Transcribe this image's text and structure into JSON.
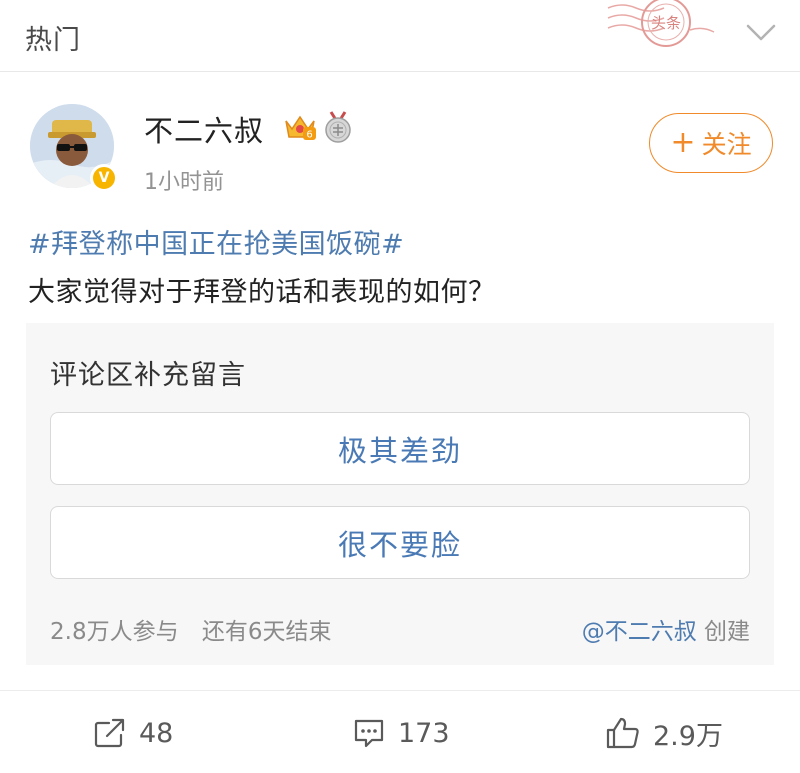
{
  "topbar": {
    "title": "热门",
    "stamp_text": "头条"
  },
  "post": {
    "username": "不二六叔",
    "verified_badge": "V",
    "time": "1小时前",
    "follow_label": "关注",
    "follow_plus": "+",
    "hashtag": "#拜登称中国正在抢美国饭碗#",
    "text": "大家觉得对于拜登的话和表现的如何？"
  },
  "poll": {
    "title": "评论区补充留言",
    "options": [
      {
        "label": "极其差劲"
      },
      {
        "label": "很不要脸"
      }
    ],
    "participants": "2.8万人参与",
    "remaining": "还有6天结束",
    "creator_link": "@不二六叔",
    "creator_suffix": "创建"
  },
  "actions": {
    "share_count": "48",
    "comment_count": "173",
    "like_count": "2.9万"
  },
  "colors": {
    "accent_orange": "#f08a2a",
    "link_blue": "#4f7cb0",
    "stamp_red": "#d9534f"
  }
}
